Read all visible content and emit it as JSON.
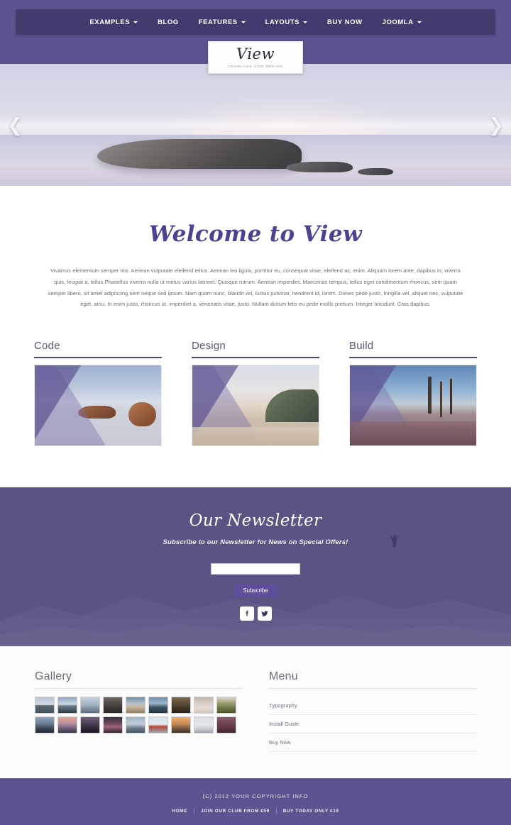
{
  "nav": {
    "items": [
      {
        "label": "EXAMPLES",
        "has_caret": true
      },
      {
        "label": "BLOG",
        "has_caret": false
      },
      {
        "label": "FEATURES",
        "has_caret": true
      },
      {
        "label": "LAYOUTS",
        "has_caret": true
      },
      {
        "label": "BUY NOW",
        "has_caret": false
      },
      {
        "label": "JOOMLA",
        "has_caret": true
      }
    ]
  },
  "logo": {
    "word": "View",
    "sub": "JOOMLAGE.COM DESIGN"
  },
  "hero": {
    "prev_icon": "❮",
    "next_icon": "❯",
    "alt": "coastal rock seascape at dusk"
  },
  "welcome": {
    "title": "Welcome to View",
    "body": "Vivamus elementum semper nisi. Aenean vulputate eleifend tellus. Aenean leo ligula, porttitor eu, consequat vitae, eleifend ac, enim. Aliquam lorem ante, dapibus in, viverra quis, feugiat a, tellus.Phasellus viverra nulla ut metus varius laoreet. Quisque rutrum. Aenean imperdiet. Maecenas tempus, tellus eget condimentum rhoncus, sem quam semper libero, sit amet adipiscing sem neque sed ipsum. Nam quam nunc, blandit vel, luctus pulvinar, hendrerit id, lorem. Donec pede justo, fringilla vel, aliquet nec, vulputate eget, arcu. In enim justo, rhoncus ut, imperdiet a, venenatis vitae, justo. Nullam dictum felis eu pede mollis pretium. Integer tincidunt. Cras dapibus."
  },
  "features": [
    {
      "title": "Code",
      "image_alt": "beach boulders at low tide"
    },
    {
      "title": "Design",
      "image_alt": "coastline with headland"
    },
    {
      "title": "Build",
      "image_alt": "wooden posts on rocky shore"
    }
  ],
  "newsletter": {
    "title": "Our Newsletter",
    "subtitle": "Subscribe to our Newsletter for News on Special Offers!",
    "input_value": "",
    "input_placeholder": "",
    "button_label": "Subscribe",
    "social": [
      {
        "name": "facebook",
        "label": "Facebook"
      },
      {
        "name": "twitter",
        "label": "Twitter"
      }
    ]
  },
  "gallery": {
    "heading": "Gallery",
    "thumbnails": [
      {
        "alt": "lake and distant island",
        "grad": "linear-gradient(to bottom,#b8c6d6 0%,#d3dbe3 48%,#5d6a74 52%,#46525c 100%)"
      },
      {
        "alt": "sunset over water",
        "grad": "linear-gradient(to bottom,#8fa7c4 0%,#cfd9e4 46%,#6d7e8c 54%,#2e3a44 100%)"
      },
      {
        "alt": "mountain ridge in haze",
        "grad": "linear-gradient(to bottom,#c5d2dd 0%,#9fb0c0 50%,#7b8c9c 75%,#5d6e7e 100%)"
      },
      {
        "alt": "two people on a bridge",
        "grad": "linear-gradient(to bottom,#6e6a62 0%,#4e4a46 40%,#3b3834 70%,#2b2824 100%)"
      },
      {
        "alt": "hiker on a summit",
        "grad": "linear-gradient(to bottom,#6f8ca6 0%,#b9c4cc 42%,#c9b79c 62%,#8e7c66 100%)"
      },
      {
        "alt": "kayak view on lake",
        "grad": "linear-gradient(to bottom,#6d8fae 0%,#9db3c6 38%,#3f5668 64%,#24333f 100%)"
      },
      {
        "alt": "autumn forest path",
        "grad": "linear-gradient(to bottom,#7c6a4e 0%,#5b4c36 40%,#3f3426 72%,#2a2219 100%)"
      },
      {
        "alt": "pale beach at dawn",
        "grad": "linear-gradient(to bottom,#c3b6ae 0%,#ddd2cb 44%,#e4dcd6 70%,#cfc4bd 100%)"
      },
      {
        "alt": "palm leaf and shoreline",
        "grad": "linear-gradient(to bottom,#d9d6cc 0%,#9aa06e 38%,#6e7a4a 66%,#4a5430 100%)"
      },
      {
        "alt": "silhouette on hilltop",
        "grad": "linear-gradient(to bottom,#8fa6bd 0%,#6c7f96 40%,#3c4654 72%,#222a36 100%)"
      },
      {
        "alt": "mountain peak at sunset",
        "grad": "linear-gradient(to bottom,#e8a58c 0%,#b88f9e 40%,#6a5f76 72%,#3b3646 100%)"
      },
      {
        "alt": "night valley lights",
        "grad": "linear-gradient(to bottom,#6b5d7b 0%,#4a3f55 42%,#2c2535 74%,#1a1622 100%)"
      },
      {
        "alt": "purple dusk field",
        "grad": "linear-gradient(to bottom,#3a2e3e 0%,#6b4a5c 40%,#a0657c 62%,#2d2430 100%)"
      },
      {
        "alt": "lighthouse on cliff",
        "grad": "linear-gradient(to bottom,#9fb4c8 0%,#c2cedb 44%,#73808e 68%,#46525e 100%)"
      },
      {
        "alt": "red boat on snow field",
        "grad": "linear-gradient(to bottom,#d6dee6 0%,#e6ecf1 46%,#b44a3c 60%,#9aa6b0 100%)"
      },
      {
        "alt": "boat at golden sunset",
        "grad": "linear-gradient(to bottom,#f0b06a 0%,#c98a55 42%,#7d5d44 70%,#3e3228 100%)"
      },
      {
        "alt": "overcast shoreline",
        "grad": "linear-gradient(to bottom,#d8dce0 0%,#e6e9ec 50%,#c2c8cd 78%,#9ba3aa 100%)"
      },
      {
        "alt": "red rock canyon",
        "grad": "linear-gradient(to bottom,#8a5a66 0%,#6e4450 40%,#5a3742 70%,#3e252e 100%)"
      }
    ]
  },
  "menu": {
    "heading": "Menu",
    "items": [
      "Typography",
      "Install Guide",
      "Buy Now"
    ]
  },
  "footer": {
    "copyright": "(C) 2012 YOUR COPYRIGHT INFO",
    "links": [
      "HOME",
      "JOIN OUR CLUB FROM €59",
      "BUY TODAY ONLY €19"
    ]
  },
  "colors": {
    "header_purple": "#5d5390",
    "navbar_purple": "#443a6d",
    "accent_purple": "#4e4687",
    "newsletter_purple": "#5a5383",
    "button_purple": "#5f4e9b",
    "heading_gray": "#6b6b73",
    "body_gray": "#6d6d75"
  }
}
